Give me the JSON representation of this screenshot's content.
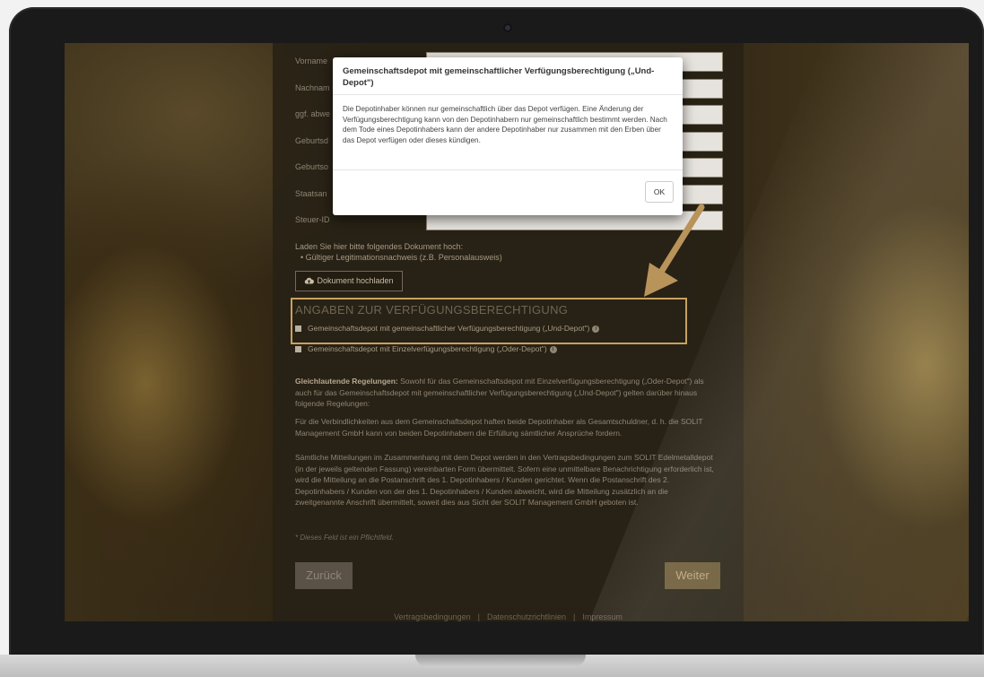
{
  "form": {
    "fields": [
      {
        "label": "Vorname"
      },
      {
        "label": "Nachnam"
      },
      {
        "label": "ggf. abwe"
      },
      {
        "label": "Geburtsd"
      },
      {
        "label": "Geburtso"
      },
      {
        "label": "Staatsan"
      },
      {
        "label": "Steuer-ID"
      }
    ],
    "upload_prompt": "Laden Sie hier bitte folgendes Dokument hoch:",
    "upload_item": "• Gültiger Legitimationsnachweis (z.B. Personalausweis)",
    "upload_button": "Dokument hochladen",
    "section_title": "ANGABEN ZUR VERFÜGUNGSBERECHTIGUNG",
    "option_und": "Gemeinschaftsdepot mit gemeinschaftlicher Verfügungsberechtigung („Und-Depot\")",
    "option_oder": "Gemeinschaftsdepot mit Einzelverfügungsberechtigung („Oder-Depot\")",
    "para1_bold": "Gleichlautende Regelungen:",
    "para1": " Sowohl für das Gemeinschaftsdepot mit Einzelverfügungsberechtigung („Oder-Depot\") als auch für das Gemeinschaftsdepot mit gemeinschaftlicher Verfügungsberechtigung („Und-Depot\") gelten darüber hinaus folgende Regelungen:",
    "para2": "Für die Verbindlichkeiten aus dem Gemeinschaftsdepot haften beide Depotinhaber als Gesamtschuldner, d. h. die SOLIT Management GmbH kann von beiden Depotinhabern die Erfüllung sämtlicher Ansprüche fordern.",
    "para3": "Sämtliche Mitteilungen im Zusammenhang mit dem Depot werden in den Vertragsbedingungen zum SOLIT Edelmetalldepot (in der jeweils geltenden Fassung) vereinbarten Form übermittelt. Sofern eine unmittelbare Benachrichtigung erforderlich ist, wird die Mitteilung an die Postanschrift des 1. Depotinhabers / Kunden gerichtet. Wenn die Postanschrift des 2. Depotinhabers / Kunden von der des 1. Depotinhabers / Kunden abweicht, wird die Mitteilung zusätzlich an die zweitgenannte Anschrift übermittelt, soweit dies aus Sicht der SOLIT Management GmbH geboten ist.",
    "required_note": "* Dieses Feld ist ein Pflichtfeld.",
    "back_button": "Zurück",
    "next_button": "Weiter"
  },
  "footer": {
    "links": [
      "Vertragsbedingungen",
      "Datenschutzrichtlinien",
      "Impressum"
    ],
    "separator": "|"
  },
  "modal": {
    "title": "Gemeinschaftsdepot mit gemeinschaftlicher Verfügungsberechtigung („Und-Depot\")",
    "body": "Die Depotinhaber können nur gemeinschaftlich über das Depot verfügen. Eine Änderung der Verfügungsberechtigung kann von den Depotinhabern nur gemeinschaftlich bestimmt werden. Nach dem Tode eines Depotinhabers kann der andere Depotinhaber nur zusammen mit den Erben über das Depot verfügen oder dieses kündigen.",
    "ok_button": "OK"
  },
  "colors": {
    "accent_gold": "#c7a25e",
    "arrow": "#b8935a"
  },
  "icons": {
    "upload": "cloud-upload-icon",
    "info": "info-icon",
    "checkbox": "checkbox-icon"
  }
}
